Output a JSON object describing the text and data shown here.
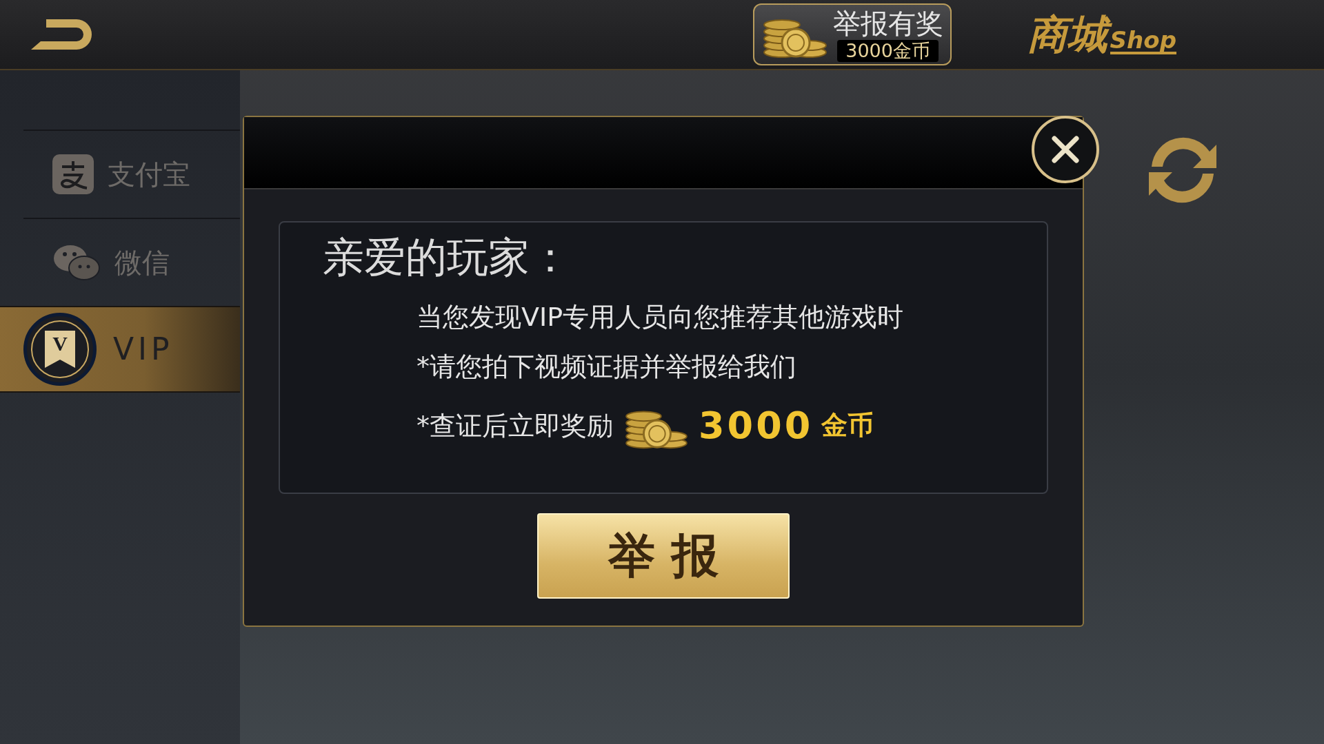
{
  "top_bar": {
    "report_badge": {
      "title": "举报有奖",
      "reward": "3000金币"
    },
    "shop_logo": {
      "title": "商城",
      "subtitle": "Shop"
    }
  },
  "sidebar": {
    "items": [
      {
        "kind": "alipay",
        "label": "支付宝",
        "selected": false
      },
      {
        "kind": "wechat",
        "label": "微信",
        "selected": false
      },
      {
        "kind": "vip",
        "label": "VIP",
        "badge_letter": "V",
        "selected": true
      }
    ]
  },
  "dialog": {
    "greeting": "亲爱的玩家：",
    "lines": [
      "当您发现VIP专用人员向您推荐其他游戏时",
      "*请您拍下视频证据并举报给我们"
    ],
    "reward_line": {
      "text": "*查证后立即奖励",
      "amount": "3000",
      "unit": "金币"
    },
    "button": "举 报"
  }
}
